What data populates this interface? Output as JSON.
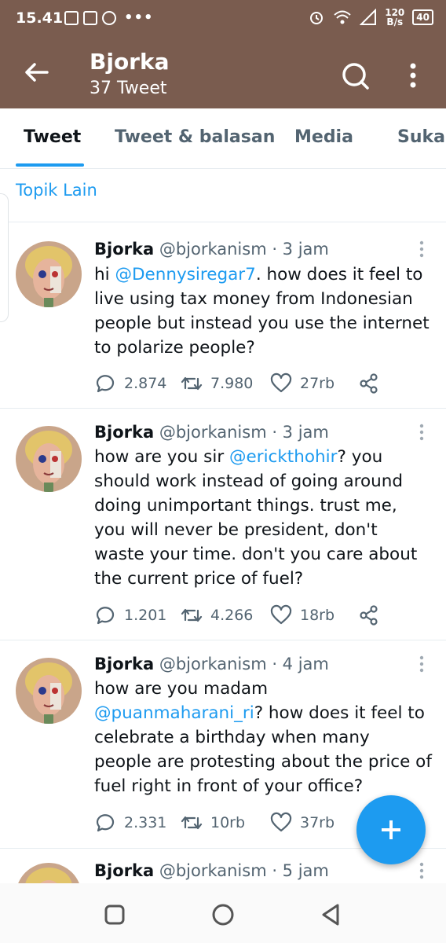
{
  "status": {
    "time": "15.41",
    "net_speed_value": "120",
    "net_speed_unit": "B/s",
    "battery": "40"
  },
  "header": {
    "title": "Bjorka",
    "subtitle": "37 Tweet",
    "bg_color": "#7a5c4f"
  },
  "tabs": [
    {
      "label": "Tweet",
      "active": true
    },
    {
      "label": "Tweet & balasan",
      "active": false
    },
    {
      "label": "Media",
      "active": false
    },
    {
      "label": "Suka",
      "active": false
    }
  ],
  "topic_link": "Topik Lain",
  "accent_color": "#1d9bf0",
  "tweets": [
    {
      "name": "Bjorka",
      "handle_time": "@bjorkanism · 3 jam",
      "text_before": "hi ",
      "mention": "@Dennysiregar7",
      "text_after": ". how does it feel to live using tax money from Indonesian people but instead you use the internet to polarize people?",
      "replies": "2.874",
      "retweets": "7.980",
      "likes": "27rb"
    },
    {
      "name": "Bjorka",
      "handle_time": "@bjorkanism · 3 jam",
      "text_before": "how are you sir ",
      "mention": "@erickthohir",
      "text_after": "? you should work instead of going around doing unimportant things. trust me, you will never be president, don't waste your time. don't you care about the current price of fuel?",
      "replies": "1.201",
      "retweets": "4.266",
      "likes": "18rb"
    },
    {
      "name": "Bjorka",
      "handle_time": "@bjorkanism · 4 jam",
      "text_before": "how are you madam ",
      "mention": "@puanmaharani_ri",
      "text_after": "? how does it feel to celebrate a birthday when many people are protesting about the price of fuel right in front of your office?",
      "replies": "2.331",
      "retweets": "10rb",
      "likes": "37rb"
    },
    {
      "name": "Bjorka",
      "handle_time": "@bjorkanism · 5 jam"
    }
  ]
}
